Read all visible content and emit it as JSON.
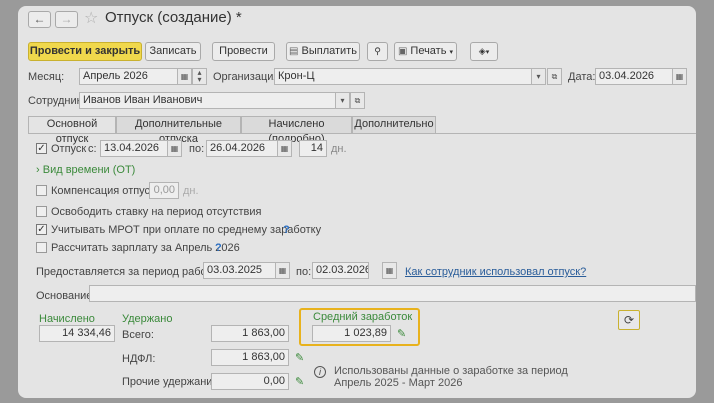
{
  "window": {
    "title": "Отпуск (создание) *"
  },
  "nav": {
    "back_icon": "←",
    "forward_icon": "→",
    "star_icon": "☆"
  },
  "toolbar": {
    "post_close": "Провести и закрыть",
    "save": "Записать",
    "post": "Провести",
    "pay": "Выплатить",
    "print": "Печать",
    "attach_icon": "🔗",
    "more_icon": "⚙"
  },
  "header": {
    "month_label": "Месяц:",
    "month_value": "Апрель 2026",
    "org_label": "Организация:",
    "org_value": "Крон-Ц",
    "date_label": "Дата:",
    "date_value": "03.04.2026",
    "employee_label": "Сотрудник:",
    "employee_value": "Иванов Иван Иванович"
  },
  "tabs": [
    "Основной отпуск",
    "Дополнительные отпуска",
    "Начислено (подробно)",
    "Дополнительно"
  ],
  "main": {
    "vacation_label": "Отпуск",
    "from_label": "с:",
    "from_value": "13.04.2026",
    "to_label": "по:",
    "to_value": "26.04.2026",
    "days_value": "14",
    "days_unit": "дн.",
    "time_type": "Вид времени (ОТ)",
    "compensation_label": "Компенсация отпуска",
    "compensation_value": "0,00",
    "compensation_unit": "дн.",
    "free_rate": "Освободить ставку на период отсутствия",
    "mrot": "Учитывать МРОТ при оплате по среднему заработку",
    "calc_salary": "Рассчитать зарплату за Апрель 2026",
    "period_label": "Предоставляется за период работы с:",
    "period_from": "03.03.2025",
    "period_to_label": "по:",
    "period_to": "02.03.2026",
    "how_used_link": "Как сотрудник использовал отпуск?",
    "basis_label": "Основание:",
    "basis_value": ""
  },
  "totals": {
    "accrued_label": "Начислено",
    "accrued_value": "14 334,46",
    "withheld_label": "Удержано",
    "total_label": "Всего:",
    "total_value": "1 863,00",
    "ndfl_label": "НДФЛ:",
    "ndfl_value": "1 863,00",
    "other_label": "Прочие удержания:",
    "other_value": "0,00",
    "avg_label": "Средний заработок",
    "avg_value": "1 023,89",
    "info_text": "Использованы данные о заработке за период Апрель 2025 - Март 2026"
  }
}
